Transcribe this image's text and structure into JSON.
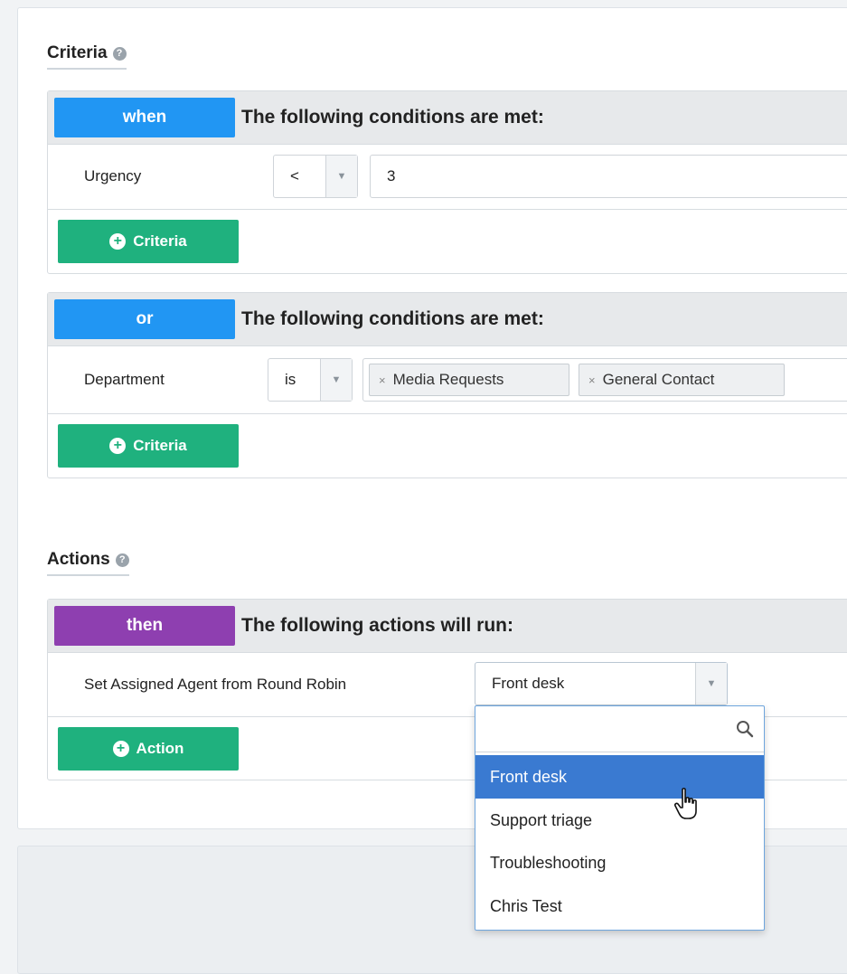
{
  "criteria": {
    "title": "Criteria",
    "help_glyph": "?",
    "groups": [
      {
        "operator": "when",
        "heading": "The following conditions are met:",
        "row": {
          "label": "Urgency",
          "comparator": "<",
          "value": "3"
        },
        "add_button": "Criteria"
      },
      {
        "operator": "or",
        "heading": "The following conditions are met:",
        "row": {
          "label": "Department",
          "comparator": "is",
          "tags": [
            "Media Requests",
            "General Contact"
          ]
        },
        "add_button": "Criteria"
      }
    ]
  },
  "actions": {
    "title": "Actions",
    "help_glyph": "?",
    "group": {
      "operator": "then",
      "heading": "The following actions will run:",
      "row": {
        "label": "Set Assigned Agent from Round Robin",
        "selected": "Front desk"
      },
      "add_button": "Action"
    }
  },
  "dropdown": {
    "search_value": "",
    "options": [
      "Front desk",
      "Support triage",
      "Troubleshooting",
      "Chris Test"
    ],
    "highlighted": "Front desk"
  },
  "colors": {
    "operator_blue": "#2196f3",
    "operator_purple": "#8e3fb0",
    "add_green": "#1fb17e",
    "highlight_blue": "#3a7ad1"
  },
  "glyphs": {
    "plus": "+",
    "caret": "▼",
    "tag_remove": "×"
  }
}
